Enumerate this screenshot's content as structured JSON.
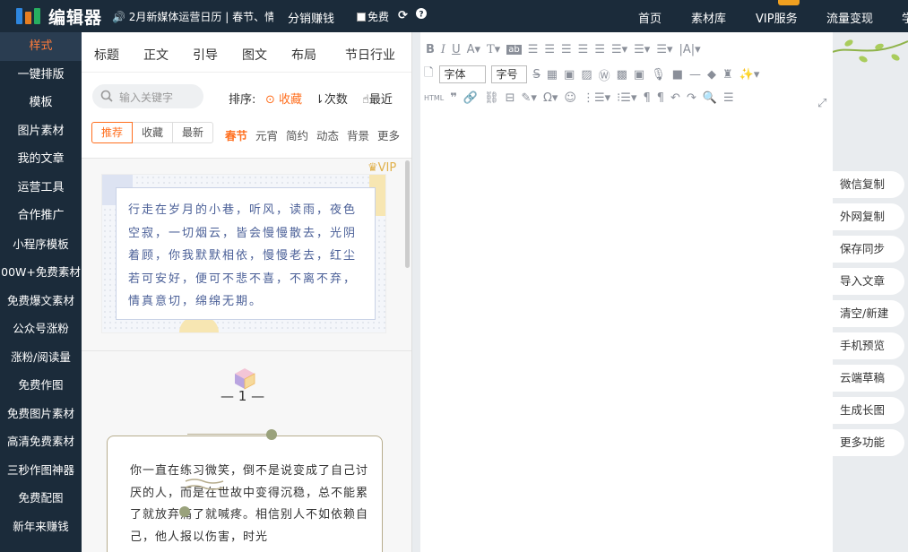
{
  "app": {
    "logo_text": "编辑器"
  },
  "topbar": {
    "notice": "🔊 2月新媒体运营日历 | 春节、情",
    "fenxiao": "分销赚钱",
    "free_label": "免费",
    "refresh_glyph": "⟳",
    "help_glyph": "?",
    "nav": [
      "首页",
      "素材库",
      "VIP服务",
      "流量变现",
      "学"
    ]
  },
  "leftnav": {
    "items": [
      "样式",
      "一键排版",
      "模板",
      "图片素材",
      "我的文章",
      "运营工具",
      "合作推广",
      "小程序模板",
      "00W+免费素材",
      "免费爆文素材",
      "公众号涨粉",
      "涨粉/阅读量",
      "免费作图",
      "免费图片素材",
      "高清免费素材",
      "三秒作图神器",
      "免费配图",
      "新年来赚钱"
    ]
  },
  "panel": {
    "tabs": [
      "标题",
      "正文",
      "引导",
      "图文",
      "布局",
      "节日行业"
    ],
    "search_placeholder": "输入关键字",
    "sort_label": "排序:",
    "sort_options": [
      "收藏",
      "次数",
      "最近"
    ],
    "segments": [
      "推荐",
      "收藏",
      "最新"
    ],
    "categories": [
      "春节",
      "元宵",
      "简约",
      "动态",
      "背景",
      "更多"
    ],
    "vip_tag": "VIP",
    "card1_text": "行走在岁月的小巷，听风，读雨，夜色空寂，一切烟云，皆会慢慢散去，光阴着顾，你我默默相依，慢慢老去，红尘若可安好，便可不悲不喜，不离不弃，情真意切，绵绵无期。",
    "number_label": "— 1 —",
    "card2_text": "你一直在练习微笑，倒不是说变成了自己讨厌的人，而是在世故中变得沉稳，总不能累了就放弃痛了就喊疼。相信别人不如依赖自己，他人报以伤害，时光"
  },
  "editor": {
    "font_family": "字体",
    "font_size": "字号",
    "html_label": "HTML"
  },
  "rightbar": {
    "actions": [
      "微信复制",
      "外网复制",
      "保存同步",
      "导入文章",
      "清空/新建",
      "手机预览",
      "云端草稿",
      "生成长图",
      "更多功能"
    ]
  },
  "colors": {
    "nav_bg": "#1b2b3a",
    "accent": "#ff6f1f",
    "quote_text": "#4a5f97"
  }
}
